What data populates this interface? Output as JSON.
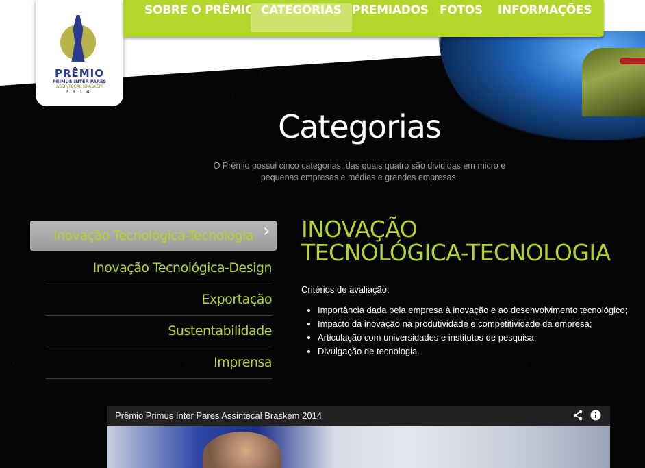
{
  "logo": {
    "title": "PRÊMIO",
    "subtitle": "PRIMUS INTER PARES",
    "tagline": "ASSINTECAL BRASKEM",
    "year": "2014"
  },
  "nav": {
    "items": [
      {
        "label": "SOBRE O PRÊMIO"
      },
      {
        "label": "CATEGORIAS"
      },
      {
        "label": "PREMIADOS"
      },
      {
        "label": "FOTOS"
      },
      {
        "label": "INFORMAÇÕES"
      }
    ],
    "active": "CATEGORIAS"
  },
  "page": {
    "title": "Categorias",
    "intro": "O Prêmio possui cinco categorias, das quais quatro são divididas em micro e pequenas empresas e médias e grandes empresas."
  },
  "categories": [
    {
      "label": "Inovação Tecnológica-Tecnologia"
    },
    {
      "label": "Inovação Tecnológica-Design"
    },
    {
      "label": "Exportação"
    },
    {
      "label": "Sustentabilidade"
    },
    {
      "label": "Imprensa"
    }
  ],
  "detail": {
    "title_line1": "INOVAÇÃO",
    "title_line2": "TECNOLÓGICA-TECNOLOGIA",
    "criteria_label": "Critérios de avaliação:",
    "criteria": [
      "Importância dada pela empresa à inovação e ao desenvolvimento tecnológico;",
      "Impacto da inovação na produtividade e competitividade da empresa;",
      "Articulação com universidades e institutos de pesquisa;",
      "Divulgação de tecnologia."
    ]
  },
  "video": {
    "title": "Prêmio Primus Inter Pares Assintecal Braskem 2014",
    "share_icon": "share-icon",
    "info_icon": "info-icon"
  },
  "colors": {
    "accent": "#b5d52d",
    "nav_active": "#cde36d",
    "background": "#050505"
  }
}
